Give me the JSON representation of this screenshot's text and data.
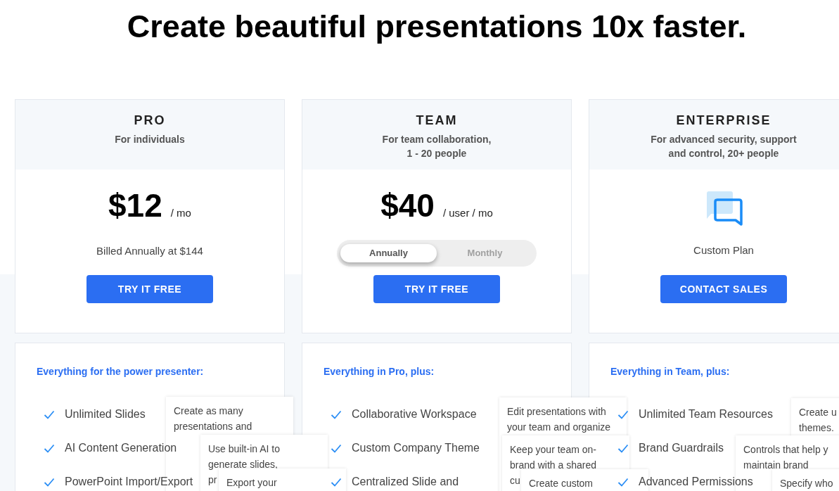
{
  "headline": "Create beautiful presentations 10x faster.",
  "plans": [
    {
      "name": "PRO",
      "subtitle": [
        "For individuals"
      ],
      "price": {
        "kind": "price",
        "amount": "$12",
        "unit": "/ mo",
        "note": "Billed Annually at $144"
      },
      "cta": "TRY IT FREE",
      "features_heading": "Everything for the power presenter:",
      "features": [
        {
          "label": "Unlimited Slides",
          "tooltip": [
            "Create as many",
            "presentations and"
          ]
        },
        {
          "label": "AI Content Generation",
          "tooltip": [
            "Use built-in AI to",
            "generate slides,",
            "pr"
          ]
        },
        {
          "label": "PowerPoint Import/Export",
          "tooltip": [
            "Export your"
          ]
        }
      ]
    },
    {
      "name": "TEAM",
      "subtitle": [
        "For team collaboration,",
        "1 - 20 people"
      ],
      "price": {
        "kind": "toggle",
        "amount": "$40",
        "unit": "/ user / mo",
        "options": [
          {
            "label": "Annually",
            "selected": true
          },
          {
            "label": "Monthly",
            "selected": false
          }
        ]
      },
      "cta": "TRY IT FREE",
      "features_heading": "Everything in Pro, plus:",
      "features": [
        {
          "label": "Collaborative Workspace",
          "tooltip": [
            "Edit presentations with",
            "your team and organize"
          ]
        },
        {
          "label": "Custom Company Theme",
          "tooltip": [
            "Keep your team on-",
            "brand with a shared",
            "cu"
          ]
        },
        {
          "label": "Centralized Slide and",
          "tooltip": [
            "Create custom"
          ]
        }
      ]
    },
    {
      "name": "ENTERPRISE",
      "subtitle": [
        "For advanced security, support",
        "and control, 20+ people"
      ],
      "price": {
        "kind": "custom",
        "label": "Custom Plan"
      },
      "cta": "CONTACT SALES",
      "features_heading": "Everything in Team, plus:",
      "features": [
        {
          "label": "Unlimited Team Resources",
          "tooltip": [
            "Create u",
            "themes."
          ]
        },
        {
          "label": "Brand Guardrails",
          "tooltip": [
            "Controls that help y",
            "maintain brand"
          ]
        },
        {
          "label": "Advanced Permissions",
          "tooltip": [
            "Specify who"
          ]
        }
      ]
    }
  ]
}
